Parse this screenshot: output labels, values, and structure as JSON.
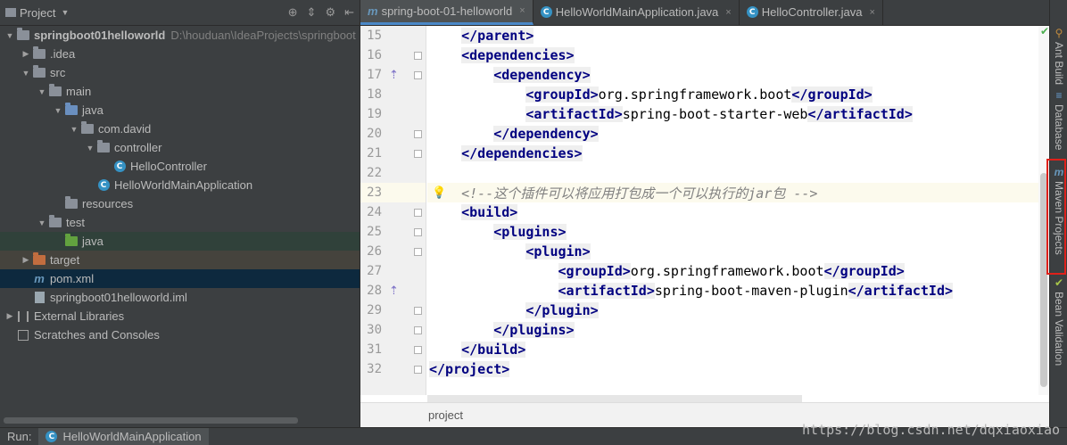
{
  "project_panel": {
    "title": "Project",
    "tools": [
      "⊕",
      "⇕",
      "⚙",
      "⇤"
    ],
    "tree": [
      {
        "label": "springboot01helloworld",
        "path": "D:\\houduan\\IdeaProjects\\springboot",
        "depth": 0,
        "arrow": "▼",
        "icon": "folder",
        "bold": true
      },
      {
        "label": ".idea",
        "depth": 1,
        "arrow": "▶",
        "icon": "folder"
      },
      {
        "label": "src",
        "depth": 1,
        "arrow": "▼",
        "icon": "folder"
      },
      {
        "label": "main",
        "depth": 2,
        "arrow": "▼",
        "icon": "folder"
      },
      {
        "label": "java",
        "depth": 3,
        "arrow": "▼",
        "icon": "folder-blue"
      },
      {
        "label": "com.david",
        "depth": 4,
        "arrow": "▼",
        "icon": "folder"
      },
      {
        "label": "controller",
        "depth": 5,
        "arrow": "▼",
        "icon": "folder"
      },
      {
        "label": "HelloController",
        "depth": 6,
        "arrow": "",
        "icon": "class"
      },
      {
        "label": "HelloWorldMainApplication",
        "depth": 5,
        "arrow": "",
        "icon": "class-run"
      },
      {
        "label": "resources",
        "depth": 3,
        "arrow": "",
        "icon": "folder-res"
      },
      {
        "label": "test",
        "depth": 2,
        "arrow": "▼",
        "icon": "folder"
      },
      {
        "label": "java",
        "depth": 3,
        "arrow": "",
        "icon": "folder-green",
        "sel": "green"
      },
      {
        "label": "target",
        "depth": 1,
        "arrow": "▶",
        "icon": "folder-orange",
        "sel": "brown"
      },
      {
        "label": "pom.xml",
        "depth": 1,
        "arrow": "",
        "icon": "maven",
        "sel": "blue"
      },
      {
        "label": "springboot01helloworld.iml",
        "depth": 1,
        "arrow": "",
        "icon": "iml"
      },
      {
        "label": "External Libraries",
        "depth": 0,
        "arrow": "▶",
        "icon": "lib"
      },
      {
        "label": "Scratches and Consoles",
        "depth": 0,
        "arrow": "",
        "icon": "scratch"
      }
    ]
  },
  "editor": {
    "tabs": [
      {
        "label": "spring-boot-01-helloworld",
        "icon": "m",
        "active": true
      },
      {
        "label": "HelloWorldMainApplication.java",
        "icon": "c",
        "active": false
      },
      {
        "label": "HelloController.java",
        "icon": "c",
        "active": false
      }
    ],
    "lines": [
      {
        "n": "15",
        "parts": [
          [
            "",
            "    "
          ],
          [
            "t",
            "</parent>"
          ]
        ]
      },
      {
        "n": "16",
        "parts": [
          [
            "",
            "    "
          ],
          [
            "t",
            "<dependencies>"
          ]
        ],
        "fold": true
      },
      {
        "n": "17",
        "parts": [
          [
            "",
            "        "
          ],
          [
            "t",
            "<dependency>"
          ]
        ],
        "fold": true,
        "mark": true
      },
      {
        "n": "18",
        "parts": [
          [
            "",
            "            "
          ],
          [
            "t",
            "<groupId>"
          ],
          [
            "",
            "org.springframework.boot"
          ],
          [
            "t",
            "</groupId>"
          ]
        ]
      },
      {
        "n": "19",
        "parts": [
          [
            "",
            "            "
          ],
          [
            "t",
            "<artifactId>"
          ],
          [
            "",
            "spring-boot-starter-web"
          ],
          [
            "t",
            "</artifactId>"
          ]
        ]
      },
      {
        "n": "20",
        "parts": [
          [
            "",
            "        "
          ],
          [
            "t",
            "</dependency>"
          ]
        ],
        "fold": true
      },
      {
        "n": "21",
        "parts": [
          [
            "",
            "    "
          ],
          [
            "t",
            "</dependencies>"
          ]
        ],
        "fold": true
      },
      {
        "n": "22",
        "parts": []
      },
      {
        "n": "23",
        "parts": [
          [
            "",
            "    "
          ],
          [
            "c",
            "<!--这个插件可以将应用打包成一个可以执行的jar包 -->"
          ]
        ],
        "current": true,
        "bulb": true
      },
      {
        "n": "24",
        "parts": [
          [
            "",
            "    "
          ],
          [
            "t",
            "<build>"
          ]
        ],
        "fold": true
      },
      {
        "n": "25",
        "parts": [
          [
            "",
            "        "
          ],
          [
            "t",
            "<plugins>"
          ]
        ],
        "fold": true
      },
      {
        "n": "26",
        "parts": [
          [
            "",
            "            "
          ],
          [
            "t",
            "<plugin>"
          ]
        ],
        "fold": true
      },
      {
        "n": "27",
        "parts": [
          [
            "",
            "                "
          ],
          [
            "t",
            "<groupId>"
          ],
          [
            "",
            "org.springframework.boot"
          ],
          [
            "t",
            "</groupId>"
          ]
        ]
      },
      {
        "n": "28",
        "parts": [
          [
            "",
            "                "
          ],
          [
            "t",
            "<artifactId>"
          ],
          [
            "",
            "spring-boot-maven-plugin"
          ],
          [
            "t",
            "</artifactId>"
          ]
        ],
        "mark": true
      },
      {
        "n": "29",
        "parts": [
          [
            "",
            "            "
          ],
          [
            "t",
            "</plugin>"
          ]
        ],
        "fold": true
      },
      {
        "n": "30",
        "parts": [
          [
            "",
            "        "
          ],
          [
            "t",
            "</plugins>"
          ]
        ],
        "fold": true
      },
      {
        "n": "31",
        "parts": [
          [
            "",
            "    "
          ],
          [
            "t",
            "</build>"
          ]
        ],
        "fold": true
      },
      {
        "n": "32",
        "parts": [
          [
            "t",
            "</project>"
          ]
        ],
        "fold": true
      }
    ],
    "breadcrumb": "project"
  },
  "right_tools": [
    {
      "label": "Ant Build",
      "icon": "🐜"
    },
    {
      "label": "Database",
      "icon": "≡"
    },
    {
      "label": "Maven Projects",
      "icon": "m"
    },
    {
      "label": "Bean Validation",
      "icon": "✓"
    }
  ],
  "run_bar": {
    "label": "Run:",
    "tab": "HelloWorldMainApplication"
  },
  "watermark": "https://blog.csdn.net/dqxiaoxiao",
  "colors": {
    "tag": "#000080",
    "comment": "#808080",
    "highlight": "#e0201a"
  }
}
